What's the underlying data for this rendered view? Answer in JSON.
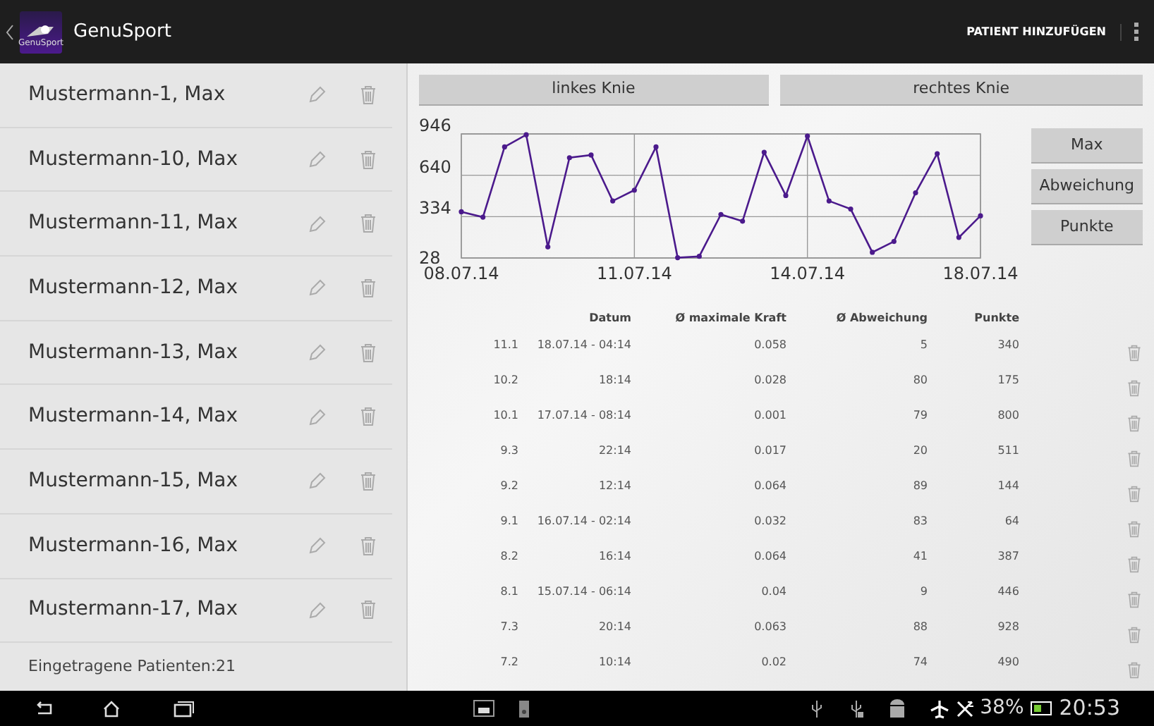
{
  "app_bar": {
    "logo_text": "GenuSport",
    "title": "GenuSport",
    "action": "PATIENT HINZUFÜGEN"
  },
  "patients": [
    {
      "name": "Mustermann-1, Max"
    },
    {
      "name": "Mustermann-10, Max"
    },
    {
      "name": "Mustermann-11, Max"
    },
    {
      "name": "Mustermann-12, Max"
    },
    {
      "name": "Mustermann-13, Max"
    },
    {
      "name": "Mustermann-14, Max"
    },
    {
      "name": "Mustermann-15, Max"
    },
    {
      "name": "Mustermann-16, Max"
    },
    {
      "name": "Mustermann-17, Max"
    }
  ],
  "patient_count": "Eingetragene Patienten:21",
  "knee_tabs": [
    {
      "label": "linkes Knie"
    },
    {
      "label": "rechtes Knie"
    }
  ],
  "chart_buttons": [
    "Max",
    "Abweichung",
    "Punkte"
  ],
  "chart_data": {
    "type": "line",
    "categories": [
      "08.07.14",
      null,
      null,
      null,
      null,
      null,
      null,
      null,
      "11.07.14",
      null,
      null,
      null,
      null,
      null,
      null,
      null,
      "14.07.14",
      null,
      null,
      null,
      null,
      null,
      null,
      null,
      "18.07.14"
    ],
    "series": [
      {
        "color": "#4b1a8c",
        "marker": "o",
        "values": [
          370,
          330,
          850,
          940,
          110,
          770,
          790,
          450,
          530,
          850,
          30,
          40,
          350,
          300,
          810,
          490,
          930,
          450,
          390,
          70,
          150,
          510,
          800,
          180,
          340
        ]
      }
    ],
    "ylim": [
      28,
      946
    ],
    "grid": true,
    "yticks": [
      28,
      334,
      640,
      946
    ]
  },
  "table": {
    "columns": [
      "Datum",
      "Ø maximale Kraft",
      "Ø Abweichung",
      "Punkte"
    ],
    "rows": [
      {
        "index": "11.1",
        "datum": "18.07.14 - 04:14",
        "kraft": "0.058",
        "abweichung": "5",
        "punkte": "340"
      },
      {
        "index": "10.2",
        "datum": "18:14",
        "kraft": "0.028",
        "abweichung": "80",
        "punkte": "175"
      },
      {
        "index": "10.1",
        "datum": "17.07.14 - 08:14",
        "kraft": "0.001",
        "abweichung": "79",
        "punkte": "800"
      },
      {
        "index": "9.3",
        "datum": "22:14",
        "kraft": "0.017",
        "abweichung": "20",
        "punkte": "511"
      },
      {
        "index": "9.2",
        "datum": "12:14",
        "kraft": "0.064",
        "abweichung": "89",
        "punkte": "144"
      },
      {
        "index": "9.1",
        "datum": "16.07.14 - 02:14",
        "kraft": "0.032",
        "abweichung": "83",
        "punkte": "64"
      },
      {
        "index": "8.2",
        "datum": "16:14",
        "kraft": "0.064",
        "abweichung": "41",
        "punkte": "387"
      },
      {
        "index": "8.1",
        "datum": "15.07.14 - 06:14",
        "kraft": "0.04",
        "abweichung": "9",
        "punkte": "446"
      },
      {
        "index": "7.3",
        "datum": "20:14",
        "kraft": "0.063",
        "abweichung": "88",
        "punkte": "928"
      },
      {
        "index": "7.2",
        "datum": "10:14",
        "kraft": "0.02",
        "abweichung": "74",
        "punkte": "490"
      }
    ]
  },
  "status_bar": {
    "battery": "38%",
    "time": "20:53"
  }
}
